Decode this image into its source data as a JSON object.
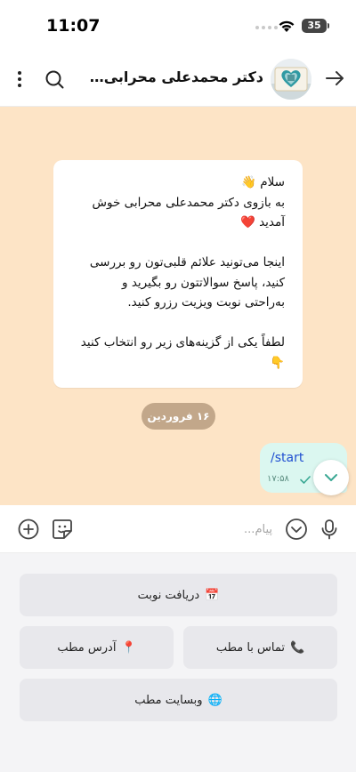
{
  "status_bar": {
    "time": "11:07",
    "battery": "35"
  },
  "header": {
    "title": "دکتر محمدعلی محرابی | فوق ..."
  },
  "messages": {
    "incoming_lines": [
      "سلام 👋",
      "به بازوی دکتر محمدعلی محرابی خوش",
      "آمدید ❤️",
      "",
      "اینجا می‌تونید علائم قلبی‌تون رو بررسی",
      "کنید، پاسخ سوالاتتون رو بگیرید و",
      "به‌راحتی نوبت ویزیت رزرو کنید.",
      "",
      "لطفاً یکی از گزینه‌های زیر رو انتخاب کنید",
      "👇"
    ],
    "date_chip": "۱۶ فروردین",
    "outgoing": {
      "text": "/start",
      "time": "۱۷:۵۸"
    }
  },
  "input": {
    "placeholder": "پیام..."
  },
  "keyboard": {
    "booking": {
      "emoji": "📅",
      "label": "دریافت نوبت"
    },
    "contact": {
      "emoji": "📞",
      "label": "تماس با مطب"
    },
    "address": {
      "emoji": "📍",
      "label": "آدرس مطب"
    },
    "website": {
      "emoji": "🌐",
      "label": "وبسایت مطب"
    }
  },
  "colors": {
    "chat_background": "#fde4c6",
    "outgoing_bubble": "#dbf7f0",
    "date_chip": "#c2a78a",
    "accent": "#3aa894"
  },
  "icons": [
    "wifi-icon",
    "battery-icon",
    "back-arrow-icon",
    "search-icon",
    "more-vertical-icon",
    "check-icon",
    "chevron-down-icon",
    "microphone-icon",
    "emoji-icon",
    "sticker-icon",
    "add-icon"
  ]
}
